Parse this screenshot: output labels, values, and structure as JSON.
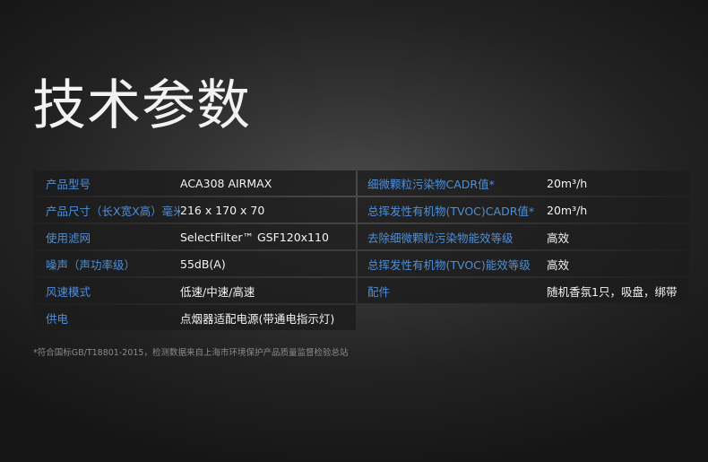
{
  "title": "技术参数",
  "specs_left": [
    {
      "label": "产品型号",
      "value": "ACA308 AIRMAX"
    },
    {
      "label": "产品尺寸（长X宽X高）毫米",
      "value": "216 x 170 x 70"
    },
    {
      "label": "使用滤网",
      "value": "SelectFilter™ GSF120x110"
    },
    {
      "label": "噪声（声功率级）",
      "value": "55dB(A)"
    },
    {
      "label": "风速模式",
      "value": "低速/中速/高速"
    },
    {
      "label": "供电",
      "value": "点烟器适配电源(带通电指示灯)"
    }
  ],
  "specs_right": [
    {
      "label": "细微颗粒污染物CADR值*",
      "value": "20m³/h"
    },
    {
      "label": "总挥发性有机物(TVOC)CADR值*",
      "value": "20m³/h"
    },
    {
      "label": "去除细微颗粒污染物能效等级",
      "value": "高效"
    },
    {
      "label": "总挥发性有机物(TVOC)能效等级",
      "value": "高效"
    },
    {
      "label": "配件",
      "value": "随机香氛1只，吸盘，绑带"
    }
  ],
  "footnote": "*符合国标GB/T18801-2015，检测数据来自上海市环境保护产品质量监督检验总站",
  "colors": {
    "label": "#4f8fd8",
    "value": "#f4f4f4",
    "row_bg": "#1c1c1c",
    "footnote": "#8a8a8a"
  }
}
